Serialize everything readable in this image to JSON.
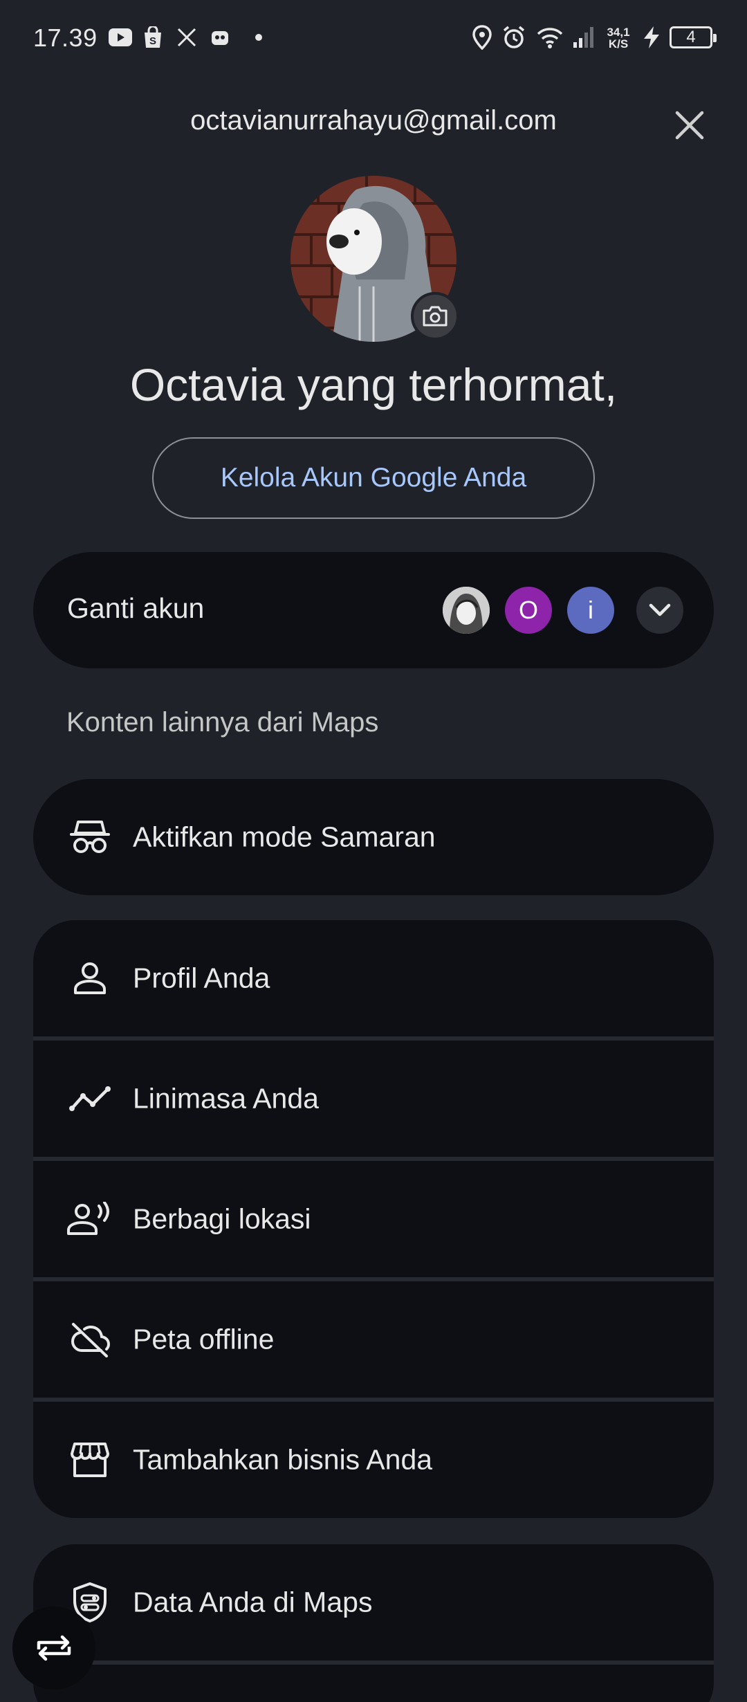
{
  "status_bar": {
    "time": "17.39",
    "speed_top": "34,1",
    "speed_bottom": "K/S",
    "battery_level": "4",
    "left_icons": [
      "youtube-icon",
      "shopping-bag-icon",
      "x-icon",
      "robot-icon",
      "dot-icon"
    ],
    "right_icons": [
      "location-icon",
      "alarm-icon",
      "wifi-icon",
      "signal-icon",
      "charging-icon",
      "battery-icon"
    ]
  },
  "header": {
    "email": "octavianurrahayu@gmail.com",
    "close_icon": "close-icon"
  },
  "profile": {
    "greeting": "Octavia yang terhormat,",
    "manage_label": "Kelola Akun Google Anda"
  },
  "switch_account": {
    "label": "Ganti akun",
    "accounts": [
      {
        "type": "photo"
      },
      {
        "initial": "O",
        "color": "#8e24aa"
      },
      {
        "initial": "i",
        "color": "#5c6bc0"
      }
    ]
  },
  "section_label": "Konten lainnya dari Maps",
  "menu": {
    "incognito": {
      "label": "Aktifkan mode Samaran",
      "icon": "incognito-icon"
    },
    "group1": [
      {
        "label": "Profil Anda",
        "icon": "person-icon"
      },
      {
        "label": "Linimasa Anda",
        "icon": "timeline-icon"
      },
      {
        "label": "Berbagi lokasi",
        "icon": "location-sharing-icon"
      },
      {
        "label": "Peta offline",
        "icon": "cloud-off-icon"
      },
      {
        "label": "Tambahkan bisnis Anda",
        "icon": "storefront-icon"
      }
    ],
    "group2": [
      {
        "label": "Data Anda di Maps",
        "icon": "shield-icon"
      }
    ]
  },
  "colors": {
    "background": "#1f2229",
    "card": "#0d0f14",
    "accent_link": "#a8c7fa"
  }
}
